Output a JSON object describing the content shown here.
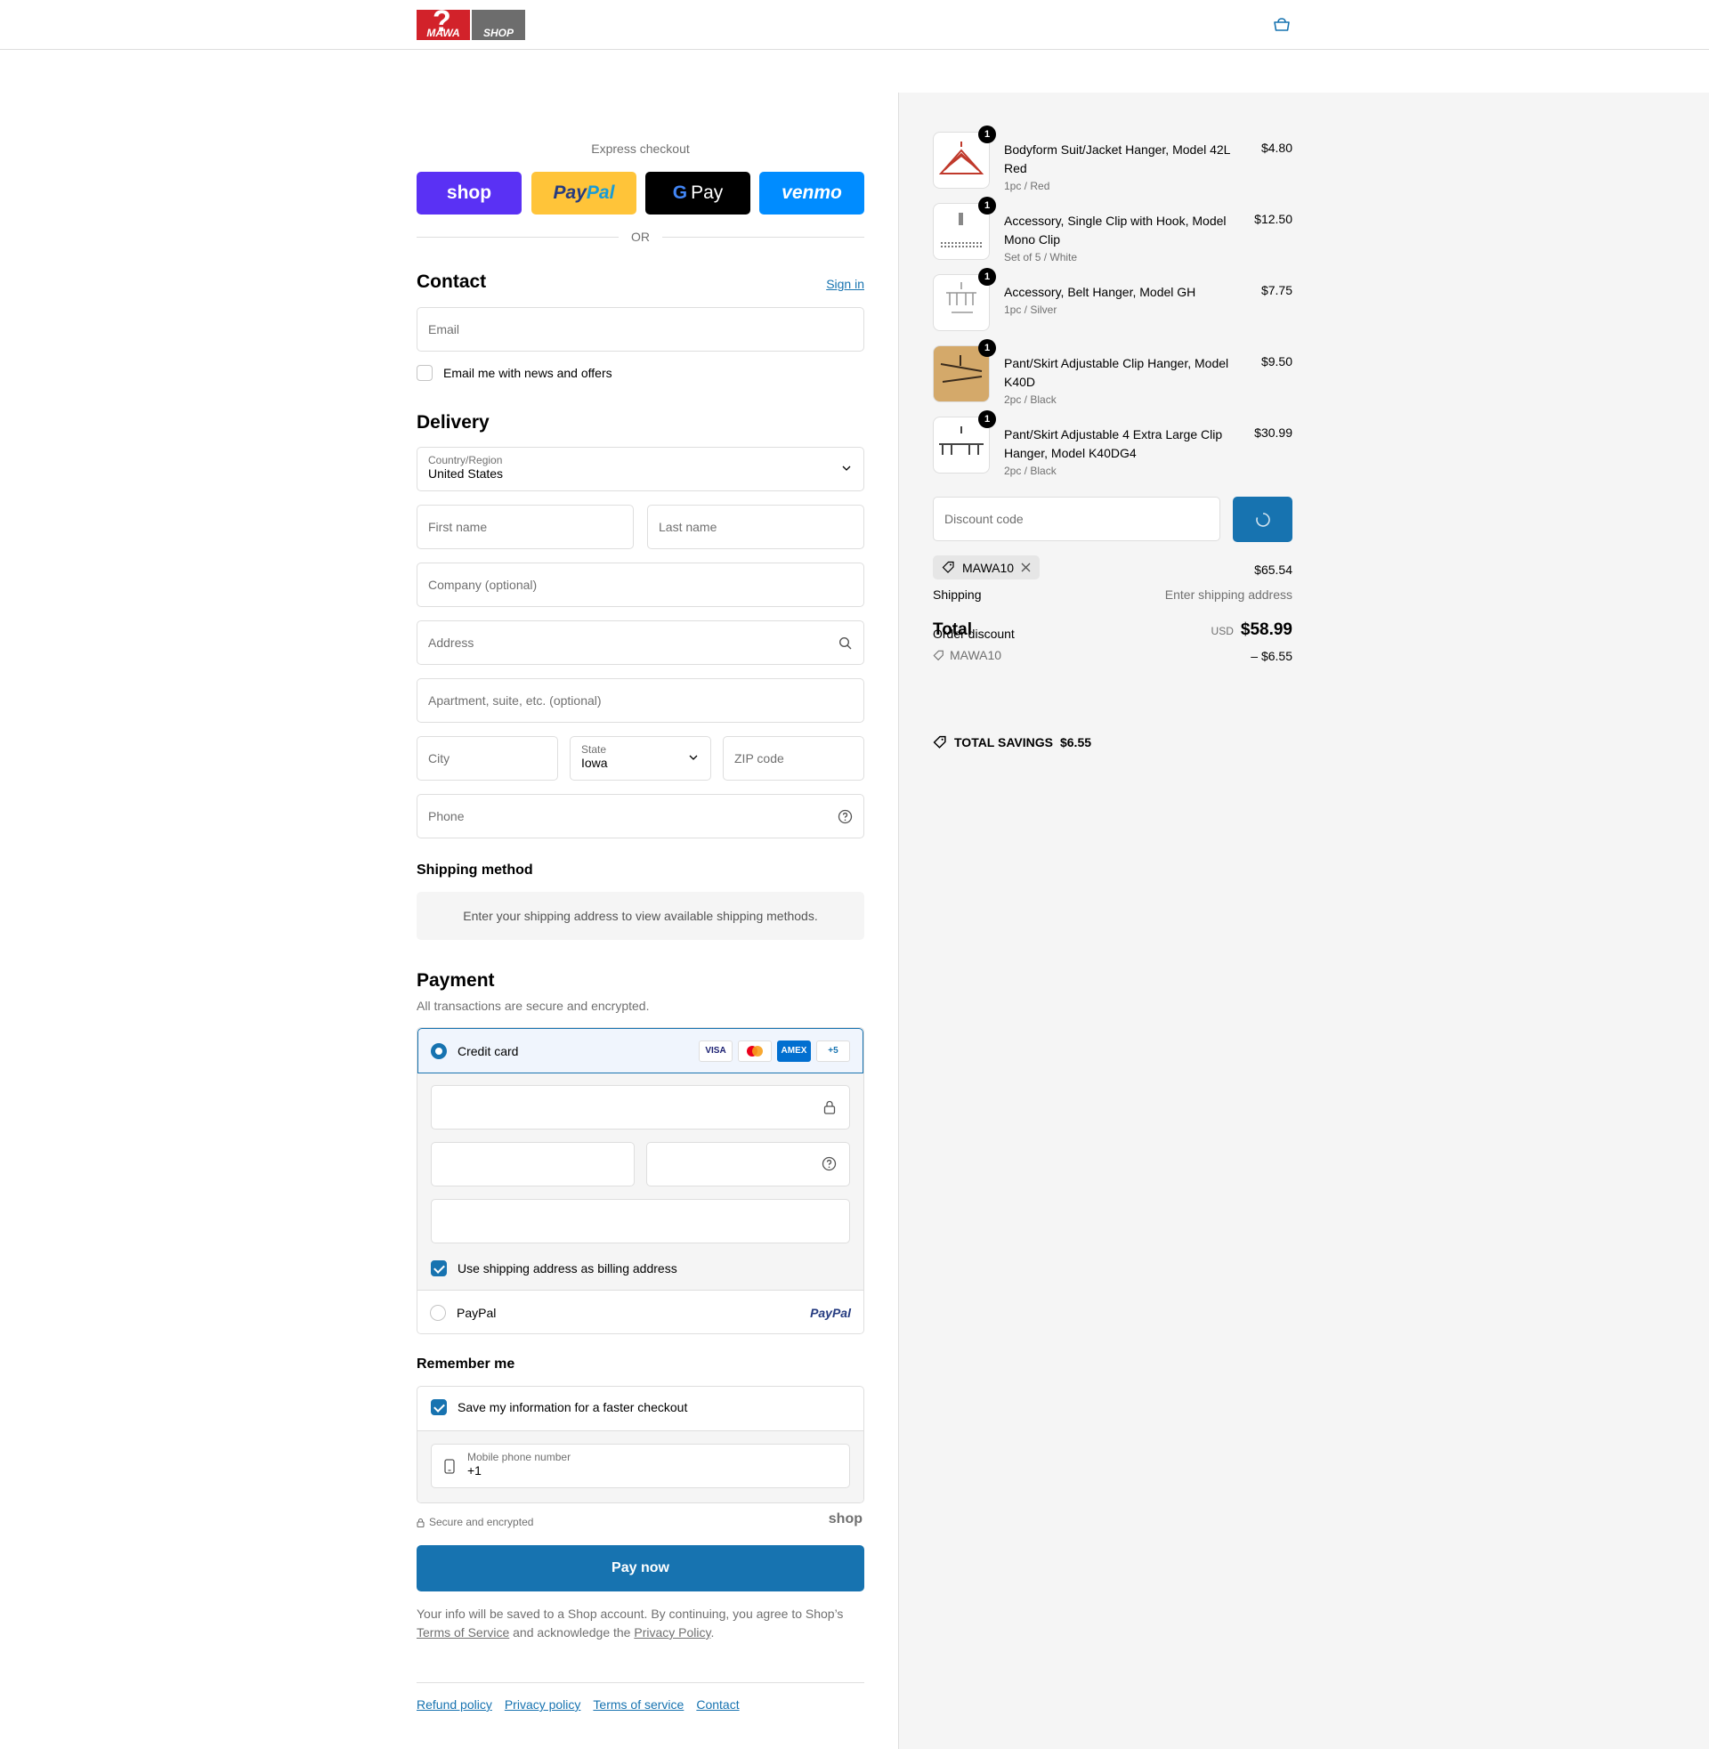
{
  "header": {
    "logo_left": "MAWA",
    "logo_right": "SHOP",
    "cart_icon": "cart-icon"
  },
  "express": {
    "title": "Express checkout",
    "shop": "shop",
    "paypal_a": "Pay",
    "paypal_b": "Pal",
    "gpay": "Pay",
    "venmo": "venmo",
    "or": "OR"
  },
  "contact": {
    "title": "Contact",
    "sign_in": "Sign in",
    "email_placeholder": "Email",
    "news_label": "Email me with news and offers"
  },
  "delivery": {
    "title": "Delivery",
    "country_label": "Country/Region",
    "country_value": "United States",
    "first_name": "First name",
    "last_name": "Last name",
    "company": "Company (optional)",
    "address": "Address",
    "apartment": "Apartment, suite, etc. (optional)",
    "city": "City",
    "state_label": "State",
    "state_value": "Iowa",
    "zip": "ZIP code",
    "phone": "Phone"
  },
  "shipping_method": {
    "title": "Shipping method",
    "info": "Enter your shipping address to view available shipping methods."
  },
  "payment": {
    "title": "Payment",
    "subtitle": "All transactions are secure and encrypted.",
    "credit_card": "Credit card",
    "visa": "VISA",
    "amex": "AMEX",
    "more": "+5",
    "billing_label": "Use shipping address as billing address",
    "paypal": "PayPal",
    "paypal_logo": "PayPal"
  },
  "remember": {
    "title": "Remember me",
    "save_label": "Save my information for a faster checkout",
    "phone_label": "Mobile phone number",
    "phone_value": "+1"
  },
  "secure": {
    "text": "Secure and encrypted",
    "shop": "shop"
  },
  "pay_now": "Pay now",
  "consent": {
    "pre": "Your info will be saved to a Shop account. By continuing, you agree to Shop’s",
    "tos": "Terms of Service",
    "mid": "and acknowledge the",
    "pp": "Privacy Policy",
    "end": "."
  },
  "footer": {
    "refund": "Refund policy",
    "privacy": "Privacy policy",
    "terms": "Terms of service",
    "contact": "Contact"
  },
  "items": [
    {
      "qty": "1",
      "name": "Bodyform Suit/Jacket Hanger, Model 42L Red",
      "variant": "1pc / Red",
      "price": "$4.80"
    },
    {
      "qty": "1",
      "name": "Accessory, Single Clip with Hook, Model Mono Clip",
      "variant": "Set of 5 / White",
      "price": "$12.50"
    },
    {
      "qty": "1",
      "name": "Accessory, Belt Hanger, Model GH",
      "variant": "1pc / Silver",
      "price": "$7.75"
    },
    {
      "qty": "1",
      "name": "Pant/Skirt Adjustable Clip Hanger, Model K40D",
      "variant": "2pc / Black",
      "price": "$9.50"
    },
    {
      "qty": "1",
      "name": "Pant/Skirt Adjustable 4 Extra Large Clip Hanger, Model K40DG4",
      "variant": "2pc / Black",
      "price": "$30.99"
    }
  ],
  "summary": {
    "discount_placeholder": "Discount code",
    "code_tag": "MAWA10",
    "subtotal_value": "$65.54",
    "shipping_label": "Shipping",
    "shipping_value": "Enter shipping address",
    "total_label": "Total",
    "order_discount_label": "Order discount",
    "currency": "USD",
    "total_value": "$58.99",
    "discount_code": "MAWA10",
    "discount_value": "– $6.55",
    "savings_label": "TOTAL SAVINGS",
    "savings_value": "$6.55"
  }
}
